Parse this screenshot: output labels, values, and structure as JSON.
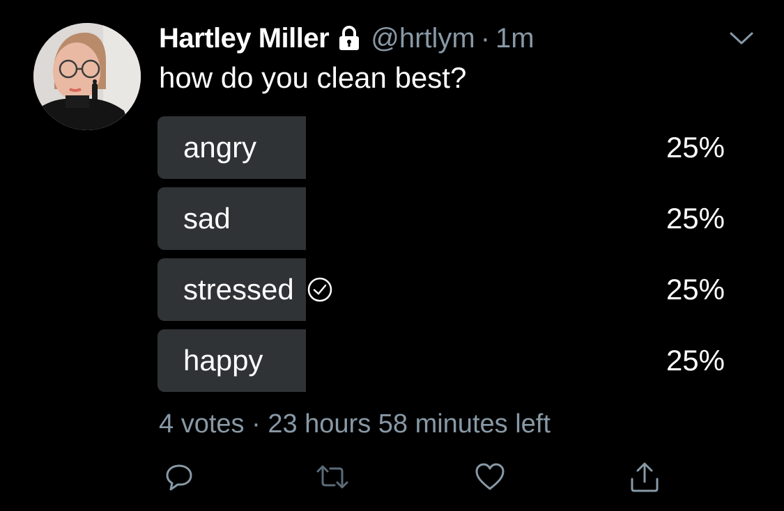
{
  "tweet": {
    "display_name": "Hartley Miller",
    "handle": "@hrtlym",
    "separator": "·",
    "time": "1m",
    "text": "how do you clean best?",
    "protected_icon": "lock-icon",
    "menu_icon": "chevron-down-icon"
  },
  "poll": {
    "options": [
      {
        "label": "angry",
        "percent": "25%",
        "fraction": 0.25,
        "selected": false
      },
      {
        "label": "sad",
        "percent": "25%",
        "fraction": 0.25,
        "selected": false
      },
      {
        "label": "stressed",
        "percent": "25%",
        "fraction": 0.25,
        "selected": true
      },
      {
        "label": "happy",
        "percent": "25%",
        "fraction": 0.25,
        "selected": false
      }
    ],
    "votes": "4 votes",
    "separator": "·",
    "time_left": "23 hours 58 minutes left"
  },
  "actions": {
    "reply_icon": "reply-icon",
    "retweet_icon": "retweet-icon",
    "like_icon": "heart-icon",
    "share_icon": "share-icon"
  },
  "colors": {
    "background": "#000000",
    "poll_bar": "#2f3336",
    "secondary_text": "#8899a6",
    "primary_text": "#ffffff"
  }
}
